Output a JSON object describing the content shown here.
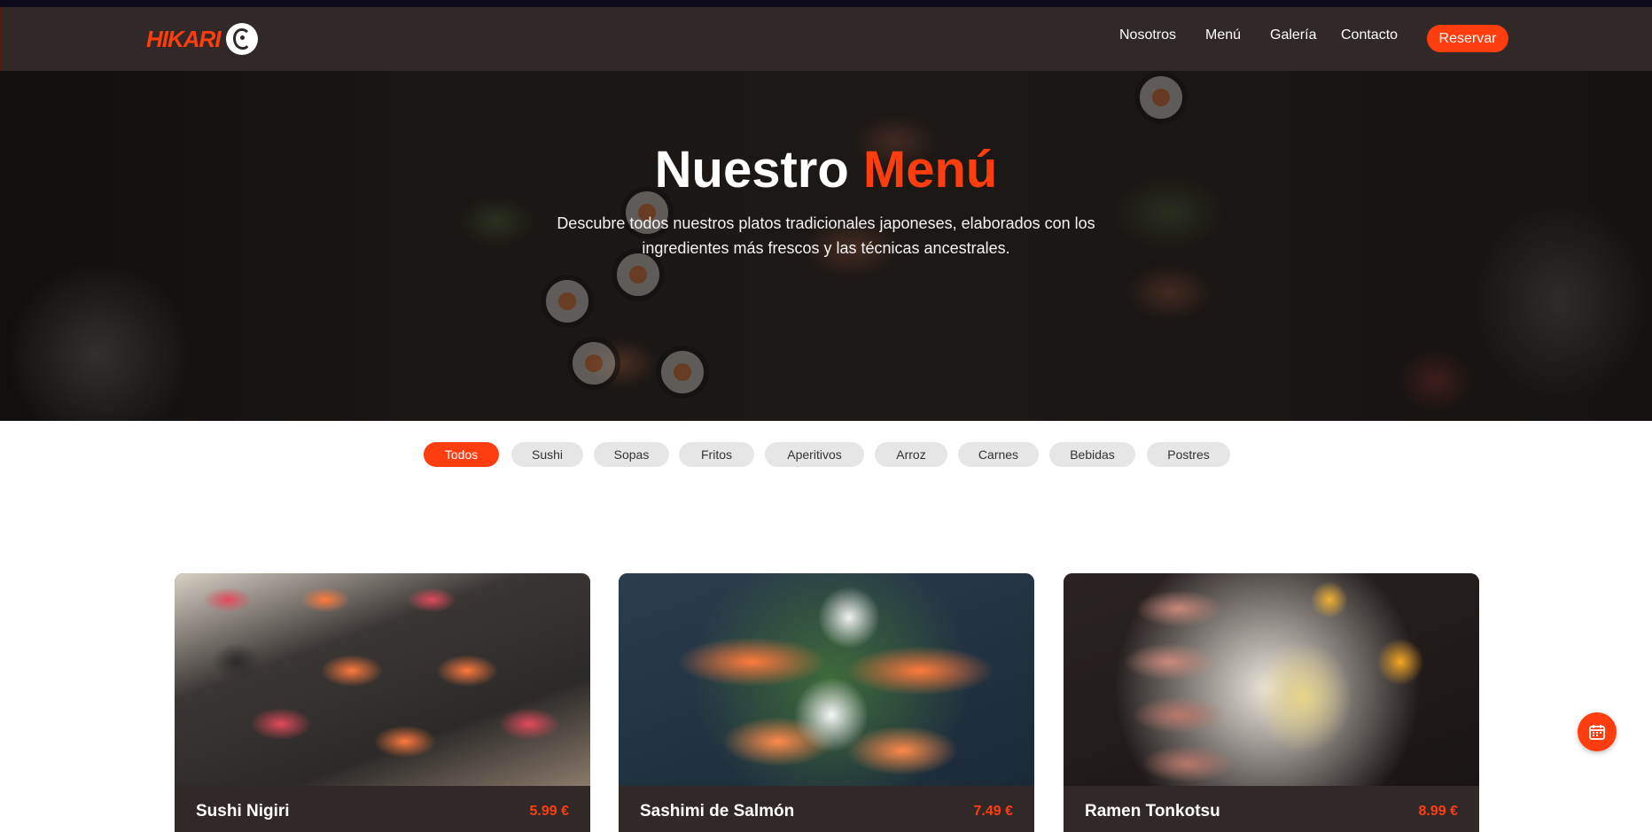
{
  "brand": {
    "logo_text": "HIKARI"
  },
  "nav": {
    "links": [
      "Nosotros",
      "Menú",
      "Galería",
      "Contacto"
    ],
    "cta": "Reservar"
  },
  "hero": {
    "title_part1": "Nuestro",
    "title_part2": "Menú",
    "subtitle": "Descubre todos nuestros platos tradicionales japoneses, elaborados con los ingredientes más frescos y las técnicas ancestrales."
  },
  "filters": {
    "active": "Todos",
    "items": [
      "Todos",
      "Sushi",
      "Sopas",
      "Fritos",
      "Aperitivos",
      "Arroz",
      "Carnes",
      "Bebidas",
      "Postres"
    ]
  },
  "menu": {
    "items": [
      {
        "name": "Sushi Nigiri",
        "price": "5.99 €"
      },
      {
        "name": "Sashimi de Salmón",
        "price": "7.49 €"
      },
      {
        "name": "Ramen Tonkotsu",
        "price": "8.99 €"
      }
    ]
  },
  "colors": {
    "accent": "#ff3d0f",
    "header": "#312927",
    "chip": "#e6e6e6"
  },
  "icons": {
    "fab": "calendar-icon",
    "logo": "dragon-emblem-icon"
  }
}
